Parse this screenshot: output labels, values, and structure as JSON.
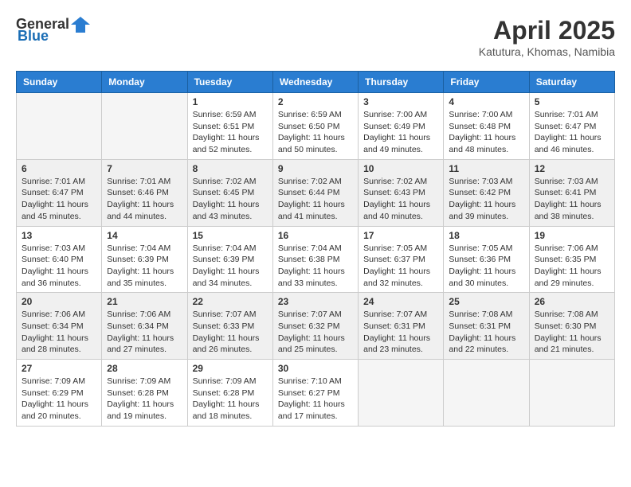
{
  "header": {
    "logo_general": "General",
    "logo_blue": "Blue",
    "month_title": "April 2025",
    "location": "Katutura, Khomas, Namibia"
  },
  "weekdays": [
    "Sunday",
    "Monday",
    "Tuesday",
    "Wednesday",
    "Thursday",
    "Friday",
    "Saturday"
  ],
  "weeks": [
    [
      {
        "day": null,
        "info": null
      },
      {
        "day": null,
        "info": null
      },
      {
        "day": "1",
        "sunrise": "Sunrise: 6:59 AM",
        "sunset": "Sunset: 6:51 PM",
        "daylight": "Daylight: 11 hours and 52 minutes."
      },
      {
        "day": "2",
        "sunrise": "Sunrise: 6:59 AM",
        "sunset": "Sunset: 6:50 PM",
        "daylight": "Daylight: 11 hours and 50 minutes."
      },
      {
        "day": "3",
        "sunrise": "Sunrise: 7:00 AM",
        "sunset": "Sunset: 6:49 PM",
        "daylight": "Daylight: 11 hours and 49 minutes."
      },
      {
        "day": "4",
        "sunrise": "Sunrise: 7:00 AM",
        "sunset": "Sunset: 6:48 PM",
        "daylight": "Daylight: 11 hours and 48 minutes."
      },
      {
        "day": "5",
        "sunrise": "Sunrise: 7:01 AM",
        "sunset": "Sunset: 6:47 PM",
        "daylight": "Daylight: 11 hours and 46 minutes."
      }
    ],
    [
      {
        "day": "6",
        "sunrise": "Sunrise: 7:01 AM",
        "sunset": "Sunset: 6:47 PM",
        "daylight": "Daylight: 11 hours and 45 minutes."
      },
      {
        "day": "7",
        "sunrise": "Sunrise: 7:01 AM",
        "sunset": "Sunset: 6:46 PM",
        "daylight": "Daylight: 11 hours and 44 minutes."
      },
      {
        "day": "8",
        "sunrise": "Sunrise: 7:02 AM",
        "sunset": "Sunset: 6:45 PM",
        "daylight": "Daylight: 11 hours and 43 minutes."
      },
      {
        "day": "9",
        "sunrise": "Sunrise: 7:02 AM",
        "sunset": "Sunset: 6:44 PM",
        "daylight": "Daylight: 11 hours and 41 minutes."
      },
      {
        "day": "10",
        "sunrise": "Sunrise: 7:02 AM",
        "sunset": "Sunset: 6:43 PM",
        "daylight": "Daylight: 11 hours and 40 minutes."
      },
      {
        "day": "11",
        "sunrise": "Sunrise: 7:03 AM",
        "sunset": "Sunset: 6:42 PM",
        "daylight": "Daylight: 11 hours and 39 minutes."
      },
      {
        "day": "12",
        "sunrise": "Sunrise: 7:03 AM",
        "sunset": "Sunset: 6:41 PM",
        "daylight": "Daylight: 11 hours and 38 minutes."
      }
    ],
    [
      {
        "day": "13",
        "sunrise": "Sunrise: 7:03 AM",
        "sunset": "Sunset: 6:40 PM",
        "daylight": "Daylight: 11 hours and 36 minutes."
      },
      {
        "day": "14",
        "sunrise": "Sunrise: 7:04 AM",
        "sunset": "Sunset: 6:39 PM",
        "daylight": "Daylight: 11 hours and 35 minutes."
      },
      {
        "day": "15",
        "sunrise": "Sunrise: 7:04 AM",
        "sunset": "Sunset: 6:39 PM",
        "daylight": "Daylight: 11 hours and 34 minutes."
      },
      {
        "day": "16",
        "sunrise": "Sunrise: 7:04 AM",
        "sunset": "Sunset: 6:38 PM",
        "daylight": "Daylight: 11 hours and 33 minutes."
      },
      {
        "day": "17",
        "sunrise": "Sunrise: 7:05 AM",
        "sunset": "Sunset: 6:37 PM",
        "daylight": "Daylight: 11 hours and 32 minutes."
      },
      {
        "day": "18",
        "sunrise": "Sunrise: 7:05 AM",
        "sunset": "Sunset: 6:36 PM",
        "daylight": "Daylight: 11 hours and 30 minutes."
      },
      {
        "day": "19",
        "sunrise": "Sunrise: 7:06 AM",
        "sunset": "Sunset: 6:35 PM",
        "daylight": "Daylight: 11 hours and 29 minutes."
      }
    ],
    [
      {
        "day": "20",
        "sunrise": "Sunrise: 7:06 AM",
        "sunset": "Sunset: 6:34 PM",
        "daylight": "Daylight: 11 hours and 28 minutes."
      },
      {
        "day": "21",
        "sunrise": "Sunrise: 7:06 AM",
        "sunset": "Sunset: 6:34 PM",
        "daylight": "Daylight: 11 hours and 27 minutes."
      },
      {
        "day": "22",
        "sunrise": "Sunrise: 7:07 AM",
        "sunset": "Sunset: 6:33 PM",
        "daylight": "Daylight: 11 hours and 26 minutes."
      },
      {
        "day": "23",
        "sunrise": "Sunrise: 7:07 AM",
        "sunset": "Sunset: 6:32 PM",
        "daylight": "Daylight: 11 hours and 25 minutes."
      },
      {
        "day": "24",
        "sunrise": "Sunrise: 7:07 AM",
        "sunset": "Sunset: 6:31 PM",
        "daylight": "Daylight: 11 hours and 23 minutes."
      },
      {
        "day": "25",
        "sunrise": "Sunrise: 7:08 AM",
        "sunset": "Sunset: 6:31 PM",
        "daylight": "Daylight: 11 hours and 22 minutes."
      },
      {
        "day": "26",
        "sunrise": "Sunrise: 7:08 AM",
        "sunset": "Sunset: 6:30 PM",
        "daylight": "Daylight: 11 hours and 21 minutes."
      }
    ],
    [
      {
        "day": "27",
        "sunrise": "Sunrise: 7:09 AM",
        "sunset": "Sunset: 6:29 PM",
        "daylight": "Daylight: 11 hours and 20 minutes."
      },
      {
        "day": "28",
        "sunrise": "Sunrise: 7:09 AM",
        "sunset": "Sunset: 6:28 PM",
        "daylight": "Daylight: 11 hours and 19 minutes."
      },
      {
        "day": "29",
        "sunrise": "Sunrise: 7:09 AM",
        "sunset": "Sunset: 6:28 PM",
        "daylight": "Daylight: 11 hours and 18 minutes."
      },
      {
        "day": "30",
        "sunrise": "Sunrise: 7:10 AM",
        "sunset": "Sunset: 6:27 PM",
        "daylight": "Daylight: 11 hours and 17 minutes."
      },
      {
        "day": null,
        "info": null
      },
      {
        "day": null,
        "info": null
      },
      {
        "day": null,
        "info": null
      }
    ]
  ]
}
